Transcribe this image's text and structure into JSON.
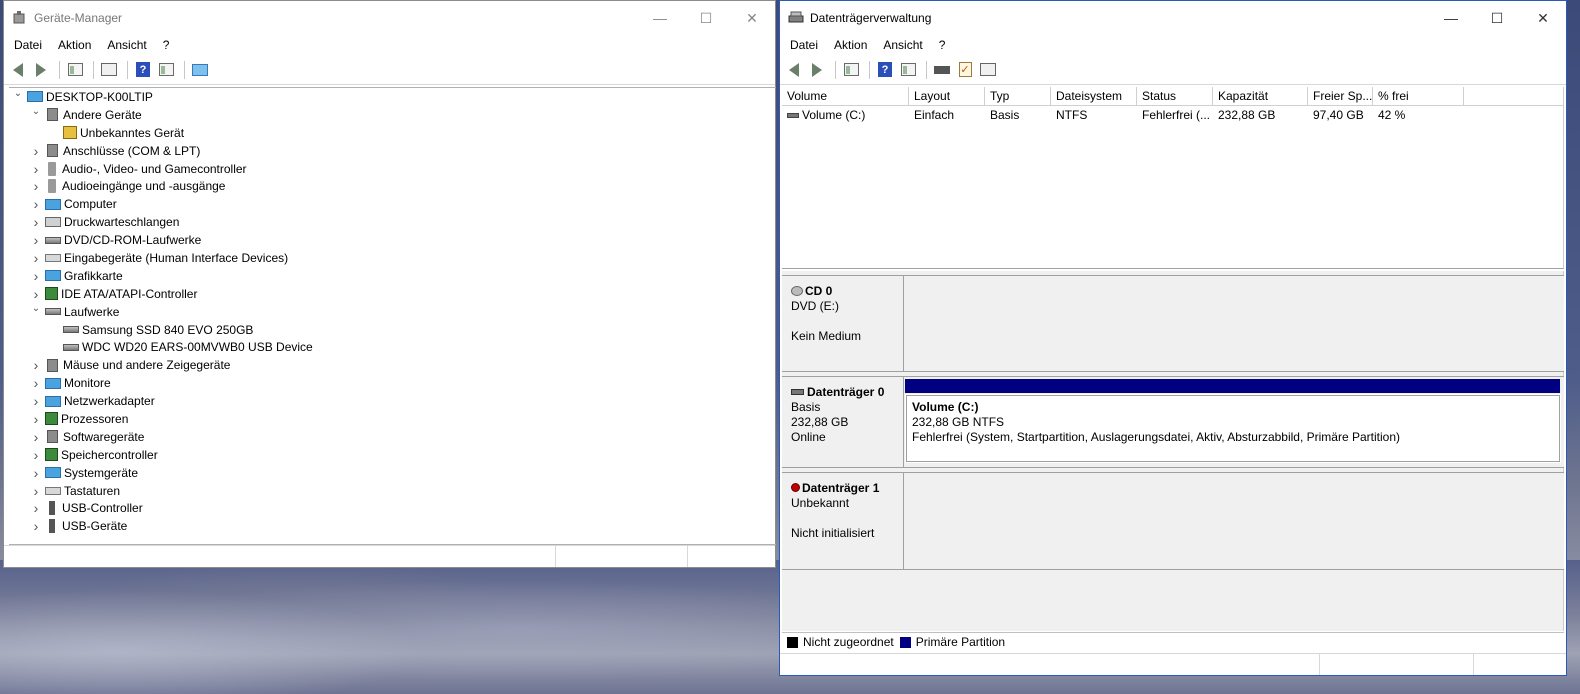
{
  "device_manager": {
    "title": "Geräte-Manager",
    "menu": [
      "Datei",
      "Aktion",
      "Ansicht",
      "?"
    ],
    "tree": [
      {
        "level": 0,
        "expander": "open",
        "icon": "computer-icon",
        "label": "DESKTOP-K00LTIP"
      },
      {
        "level": 1,
        "expander": "open",
        "icon": "unknown-device-icon",
        "label": "Andere Geräte"
      },
      {
        "level": 2,
        "expander": "none",
        "icon": "warning-device-icon",
        "label": "Unbekanntes Gerät"
      },
      {
        "level": 1,
        "expander": "closed",
        "icon": "port-icon",
        "label": "Anschlüsse (COM & LPT)"
      },
      {
        "level": 1,
        "expander": "closed",
        "icon": "speaker-icon",
        "label": "Audio-, Video- und Gamecontroller"
      },
      {
        "level": 1,
        "expander": "closed",
        "icon": "speaker-icon",
        "label": "Audioeingänge und -ausgänge"
      },
      {
        "level": 1,
        "expander": "closed",
        "icon": "monitor-icon",
        "label": "Computer"
      },
      {
        "level": 1,
        "expander": "closed",
        "icon": "printer-icon",
        "label": "Druckwarteschlangen"
      },
      {
        "level": 1,
        "expander": "closed",
        "icon": "dvd-drive-icon",
        "label": "DVD/CD-ROM-Laufwerke"
      },
      {
        "level": 1,
        "expander": "closed",
        "icon": "hid-icon",
        "label": "Eingabegeräte (Human Interface Devices)"
      },
      {
        "level": 1,
        "expander": "closed",
        "icon": "display-adapter-icon",
        "label": "Grafikkarte"
      },
      {
        "level": 1,
        "expander": "closed",
        "icon": "ide-controller-icon",
        "label": "IDE ATA/ATAPI-Controller"
      },
      {
        "level": 1,
        "expander": "open",
        "icon": "disk-drive-icon",
        "label": "Laufwerke"
      },
      {
        "level": 2,
        "expander": "none",
        "icon": "disk-drive-icon",
        "label": "Samsung SSD 840 EVO 250GB"
      },
      {
        "level": 2,
        "expander": "none",
        "icon": "disk-drive-icon",
        "label": "WDC WD20 EARS-00MVWB0 USB Device"
      },
      {
        "level": 1,
        "expander": "closed",
        "icon": "mouse-icon",
        "label": "Mäuse und andere Zeigegeräte"
      },
      {
        "level": 1,
        "expander": "closed",
        "icon": "monitor-icon",
        "label": "Monitore"
      },
      {
        "level": 1,
        "expander": "closed",
        "icon": "network-adapter-icon",
        "label": "Netzwerkadapter"
      },
      {
        "level": 1,
        "expander": "closed",
        "icon": "processor-icon",
        "label": "Prozessoren"
      },
      {
        "level": 1,
        "expander": "closed",
        "icon": "software-device-icon",
        "label": "Softwaregeräte"
      },
      {
        "level": 1,
        "expander": "closed",
        "icon": "storage-controller-icon",
        "label": "Speichercontroller"
      },
      {
        "level": 1,
        "expander": "closed",
        "icon": "system-device-icon",
        "label": "Systemgeräte"
      },
      {
        "level": 1,
        "expander": "closed",
        "icon": "keyboard-icon",
        "label": "Tastaturen"
      },
      {
        "level": 1,
        "expander": "closed",
        "icon": "usb-icon",
        "label": "USB-Controller"
      },
      {
        "level": 1,
        "expander": "closed",
        "icon": "usb-icon",
        "label": "USB-Geräte"
      }
    ]
  },
  "disk_management": {
    "title": "Datenträgerverwaltung",
    "menu": [
      "Datei",
      "Aktion",
      "Ansicht",
      "?"
    ],
    "columns": [
      "Volume",
      "Layout",
      "Typ",
      "Dateisystem",
      "Status",
      "Kapazität",
      "Freier Sp...",
      "% frei"
    ],
    "rows": [
      [
        "Volume (C:)",
        "Einfach",
        "Basis",
        "NTFS",
        "Fehlerfrei (...",
        "232,88 GB",
        "97,40 GB",
        "42 %"
      ]
    ],
    "disks": [
      {
        "name": "CD 0",
        "line1": "DVD (E:)",
        "line2": "",
        "line3": "Kein Medium",
        "icon": "cd-icon",
        "partition": null
      },
      {
        "name": "Datenträger 0",
        "line1": "Basis",
        "line2": "232,88 GB",
        "line3": "Online",
        "icon": "disk-icon",
        "partition": {
          "name": "Volume  (C:)",
          "size": "232,88 GB NTFS",
          "status": "Fehlerfrei (System, Startpartition, Auslagerungsdatei, Aktiv, Absturzabbild, Primäre Partition)"
        }
      },
      {
        "name": "Datenträger 1",
        "line1": "Unbekannt",
        "line2": "",
        "line3": "Nicht initialisiert",
        "icon": "disk-error-icon",
        "partition": null
      }
    ],
    "legend": [
      {
        "label": "Nicht zugeordnet",
        "color": "#000000"
      },
      {
        "label": "Primäre Partition",
        "color": "#000080"
      }
    ]
  }
}
